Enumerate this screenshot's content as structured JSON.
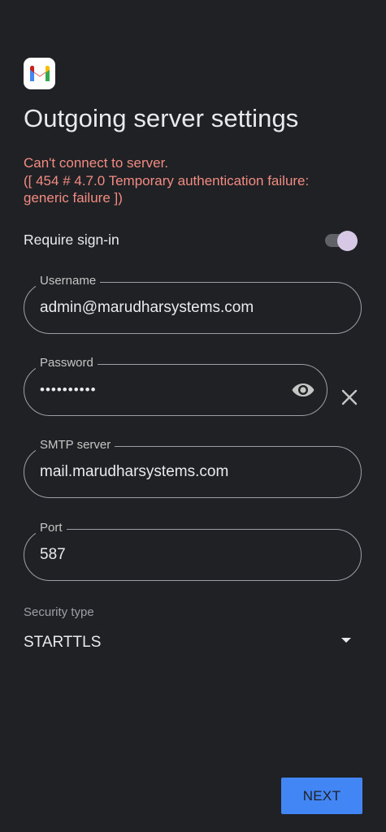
{
  "header": {
    "logo_icon": "gmail-logo-icon",
    "title": "Outgoing server settings"
  },
  "error": {
    "line1": "Can't connect to server.",
    "line2": "([ 454 # 4.7.0 Temporary authentication failure:",
    "line3": "generic failure ])",
    "color": "#f28b82"
  },
  "require_signin": {
    "label": "Require sign-in",
    "enabled": true
  },
  "fields": {
    "username": {
      "label": "Username",
      "value": "admin@marudharsystems.com"
    },
    "password": {
      "label": "Password",
      "value": "••••••••••",
      "show_icon": "eye-icon",
      "clear_icon": "close-icon"
    },
    "smtp_server": {
      "label": "SMTP server",
      "value": "mail.marudharsystems.com"
    },
    "port": {
      "label": "Port",
      "value": "587"
    }
  },
  "security": {
    "label": "Security type",
    "value": "STARTTLS",
    "icon": "dropdown-arrow-icon"
  },
  "actions": {
    "next_label": "NEXT",
    "accent": "#4285f4"
  },
  "colors": {
    "background": "#202124",
    "text": "#e8eaed",
    "toggle_thumb": "#d7c8e6"
  }
}
